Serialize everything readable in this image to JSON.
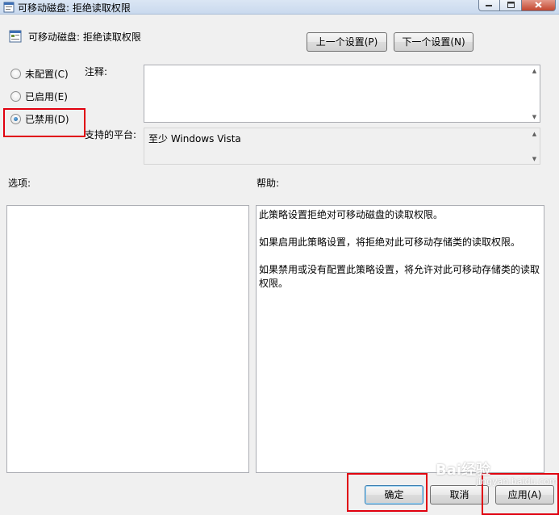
{
  "window": {
    "title": "可移动磁盘: 拒绝读取权限",
    "policy_name": "可移动磁盘: 拒绝读取权限"
  },
  "nav": {
    "prev_label": "上一个设置(P)",
    "next_label": "下一个设置(N)"
  },
  "state": {
    "options": [
      {
        "label": "未配置(C)",
        "checked": false
      },
      {
        "label": "已启用(E)",
        "checked": false
      },
      {
        "label": "已禁用(D)",
        "checked": true
      }
    ]
  },
  "comment": {
    "label": "注释:",
    "value": ""
  },
  "platform": {
    "label": "支持的平台:",
    "value": "至少 Windows Vista"
  },
  "options_panel": {
    "label": "选项:"
  },
  "help_panel": {
    "label": "帮助:",
    "paragraphs": [
      "此策略设置拒绝对可移动磁盘的读取权限。",
      "如果启用此策略设置，将拒绝对此可移动存储类的读取权限。",
      "如果禁用或没有配置此策略设置，将允许对此可移动存储类的读取权限。"
    ]
  },
  "footer": {
    "ok_label": "确定",
    "cancel_label": "取消",
    "apply_label": "应用(A)"
  },
  "watermark": {
    "text": "Bai经验",
    "sub": "jingyan.baidu.com"
  },
  "colors": {
    "highlight_box": "#e0000f",
    "titlebar": "#c9d9ee",
    "dialog_bg": "#f0f0f0"
  }
}
